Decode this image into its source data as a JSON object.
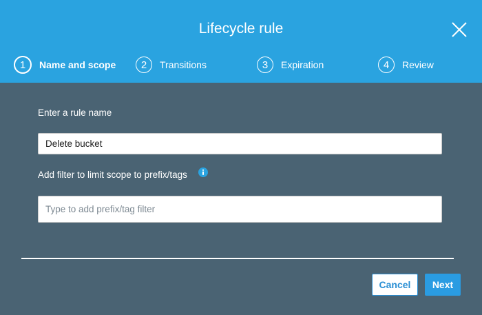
{
  "dialog": {
    "title": "Lifecycle rule",
    "close_icon": "close-icon"
  },
  "steps": [
    {
      "number": "1",
      "label": "Name and scope",
      "active": true
    },
    {
      "number": "2",
      "label": "Transitions",
      "active": false
    },
    {
      "number": "3",
      "label": "Expiration",
      "active": false
    },
    {
      "number": "4",
      "label": "Review",
      "active": false
    }
  ],
  "form": {
    "rule_name_label": "Enter a rule name",
    "rule_name_value": "Delete bucket",
    "filter_label": "Add filter to limit scope to prefix/tags",
    "filter_info_icon": "info-icon",
    "filter_placeholder": "Type to add prefix/tag filter",
    "filter_value": ""
  },
  "footer": {
    "cancel_label": "Cancel",
    "next_label": "Next"
  },
  "colors": {
    "header_bg": "#2aa3e0",
    "body_bg": "#4a6373",
    "primary": "#2a9ce2",
    "info_icon": "#2aa3e0"
  }
}
